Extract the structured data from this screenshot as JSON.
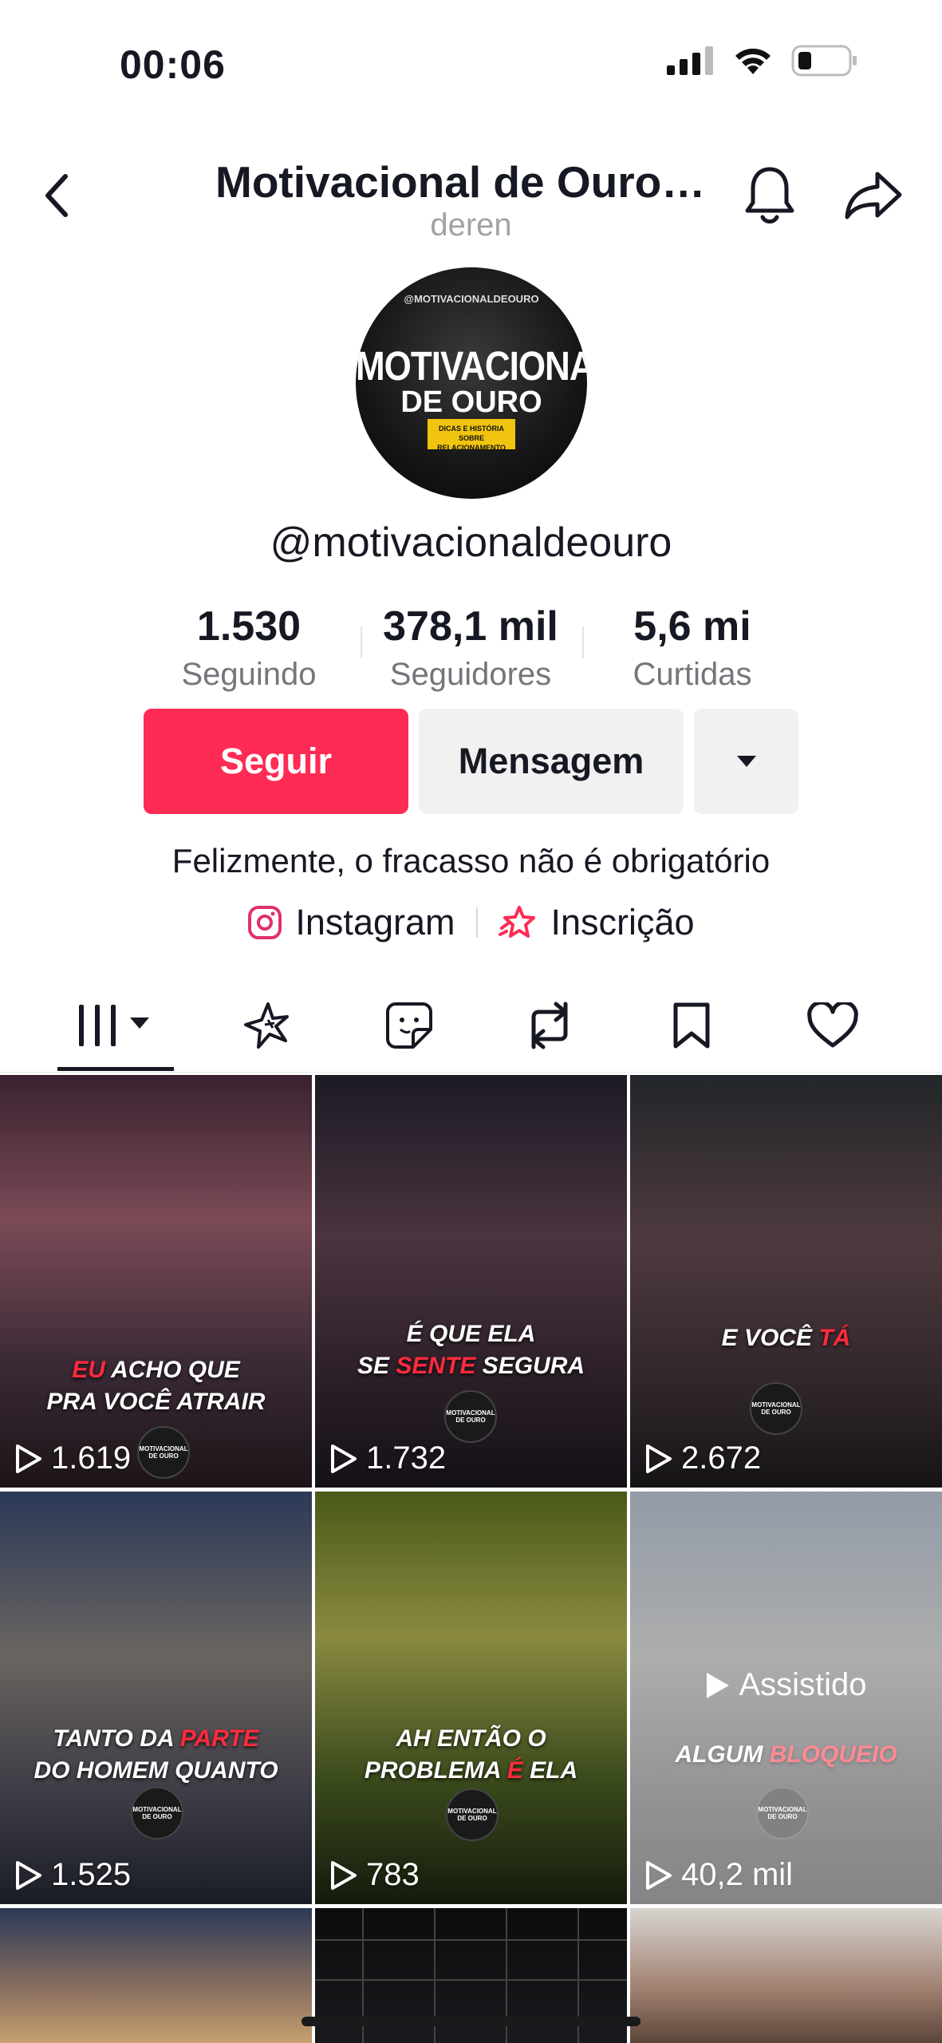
{
  "status": {
    "time": "00:06"
  },
  "header": {
    "title": "Motivacional de Ouro…",
    "subtitle": "deren"
  },
  "avatar": {
    "top_text": "@MOTIVACIONALDEOURO",
    "line1": "MOTIVACIONAL",
    "line2": "DE OURO",
    "badge": "DICAS E HISTÓRIA SOBRE RELACIONAMENTO"
  },
  "profile": {
    "handle": "@motivacionaldeouro",
    "stats": [
      {
        "value": "1.530",
        "label": "Seguindo"
      },
      {
        "value": "378,1 mil",
        "label": "Seguidores"
      },
      {
        "value": "5,6 mi",
        "label": "Curtidas"
      }
    ],
    "follow_label": "Seguir",
    "message_label": "Mensagem",
    "bio": "Felizmente, o fracasso não é obrigatório",
    "links": [
      {
        "label": "Instagram",
        "icon": "instagram-icon"
      },
      {
        "label": "Inscrição",
        "icon": "subscription-star-icon"
      }
    ]
  },
  "tabs": [
    "videos-grid-icon",
    "sparkle-icon",
    "sticker-icon",
    "repost-icon",
    "bookmark-icon",
    "heart-icon"
  ],
  "videos": [
    {
      "caption_pre": "",
      "caption_hl": "EU",
      "caption_post": " ACHO QUE",
      "caption_line2": "PRA VOCÊ ATRAIR",
      "views": "1.619",
      "logo_text": "MOTIVACIONAL DE OURO"
    },
    {
      "caption_pre": "É QUE ELA",
      "caption_hl": "",
      "caption_post": "",
      "caption_line2_pre": "SE ",
      "caption_line2_hl": "SENTE",
      "caption_line2_post": " SEGURA",
      "views": "1.732",
      "logo_text": "MOTIVACIONAL DE OURO"
    },
    {
      "caption_pre": "E VOCÊ ",
      "caption_hl": "TÁ",
      "caption_post": "",
      "views": "2.672",
      "logo_text": "MOTIVACIONAL DE OURO"
    },
    {
      "caption_pre": "TANTO DA ",
      "caption_hl": "PARTE",
      "caption_post": "",
      "caption_line2": "DO HOMEM QUANTO",
      "views": "1.525",
      "logo_text": "MOTIVACIONAL DE OURO"
    },
    {
      "caption_pre": "AH ENTÃO O",
      "caption_line2_pre": "PROBLEMA ",
      "caption_line2_hl": "É",
      "caption_line2_post": " ELA",
      "views": "783",
      "logo_text": "MOTIVACIONAL DE OURO"
    },
    {
      "caption_pre": "ALGUM ",
      "caption_hl": "BLOQUEIO",
      "caption_post": "",
      "views": "40,2 mil",
      "watched_label": "Assistido",
      "logo_text": "MOTIVACIONAL DE OURO"
    }
  ]
}
